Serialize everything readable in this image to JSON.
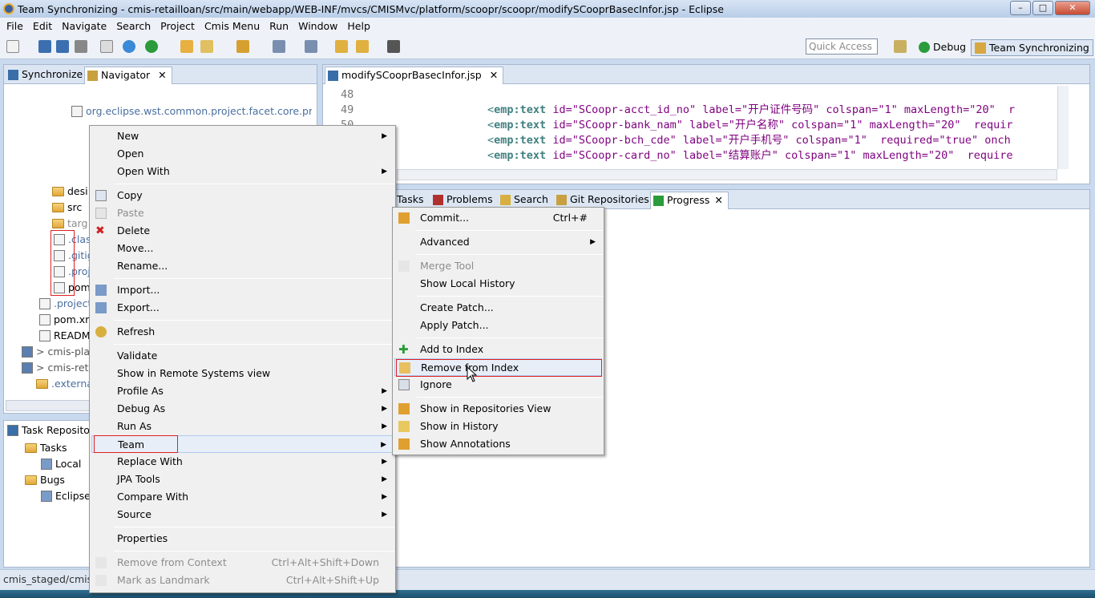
{
  "window": {
    "title": "Team Synchronizing - cmis-retailloan/src/main/webapp/WEB-INF/mvcs/CMISMvc/platform/scoopr/scoopr/modifySCooprBasecInfor.jsp - Eclipse",
    "minimize": "–",
    "maximize": "□",
    "close": "✕"
  },
  "menubar": [
    "File",
    "Edit",
    "Navigate",
    "Search",
    "Project",
    "Cmis Menu",
    "Run",
    "Window",
    "Help"
  ],
  "toolbar": {
    "quick_access_placeholder": "Quick Access",
    "perspective_debug": "Debug",
    "perspective_team": "Team Synchronizing"
  },
  "left_views": {
    "tab_synchronize": "Synchronize",
    "tab_navigator": "Navigator",
    "tree": [
      "org.eclipse.wst.common.project.facet.core.pref",
      "desi",
      "src",
      "targ",
      ".clas",
      ".gitig",
      ".proj",
      "pom",
      ".project",
      "pom.xml",
      "README",
      "> cmis-platform",
      "> cmis-retailloan",
      ".externalToolBuilders"
    ]
  },
  "task_repos": {
    "tab": "Task Repositories",
    "tasks": "Tasks",
    "local": "Local",
    "bugs": "Bugs",
    "eclipse": "Eclipse"
  },
  "editor": {
    "tab": "modifySCooprBasecInfor.jsp",
    "lines": [
      {
        "num": "48",
        "code": ""
      },
      {
        "num": "49",
        "tag": "emp:text",
        "attrs": "id=\"SCoopr-acct_id_no\" label=\"开户证件号码\" colspan=\"1\" maxLength=\"20\"  r"
      },
      {
        "num": "50",
        "tag": "emp:text",
        "attrs": "id=\"SCoopr-bank_nam\" label=\"开户名称\" colspan=\"1\" maxLength=\"20\"  requir"
      },
      {
        "num": "51",
        "tag": "emp:text",
        "attrs": "id=\"SCoopr-bch_cde\" label=\"开户手机号\" colspan=\"1\"  required=\"true\" onch"
      },
      {
        "num": "52",
        "tag": "emp:text",
        "attrs": "id=\"SCoopr-card_no\" label=\"结算账户\" colspan=\"1\" maxLength=\"20\"  require"
      }
    ]
  },
  "bottom_tabs": {
    "tasks": "Tasks",
    "problems": "Problems",
    "search": "Search",
    "git_repos": "Git Repositories",
    "progress": "Progress"
  },
  "context_menu": {
    "new": "New",
    "open": "Open",
    "open_with": "Open With",
    "copy": "Copy",
    "paste": "Paste",
    "delete": "Delete",
    "move": "Move...",
    "rename": "Rename...",
    "import": "Import...",
    "export": "Export...",
    "refresh": "Refresh",
    "validate": "Validate",
    "show_remote": "Show in Remote Systems view",
    "profile_as": "Profile As",
    "debug_as": "Debug As",
    "run_as": "Run As",
    "team": "Team",
    "replace_with": "Replace With",
    "jpa_tools": "JPA Tools",
    "compare_with": "Compare With",
    "source": "Source",
    "properties": "Properties",
    "remove_context": "Remove from Context",
    "remove_context_acc": "Ctrl+Alt+Shift+Down",
    "landmark": "Mark as Landmark",
    "landmark_acc": "Ctrl+Alt+Shift+Up"
  },
  "team_menu": {
    "commit": "Commit...",
    "commit_acc": "Ctrl+#",
    "advanced": "Advanced",
    "merge_tool": "Merge Tool",
    "local_history": "Show Local History",
    "create_patch": "Create Patch...",
    "apply_patch": "Apply Patch...",
    "add_index": "Add to Index",
    "remove_index": "Remove from Index",
    "ignore": "Ignore",
    "repos_view": "Show in Repositories View",
    "history": "Show in History",
    "annotations": "Show Annotations"
  },
  "status": {
    "text": "cmis_staged/cmis-"
  },
  "colors": {
    "accent_red": "#e02020",
    "tag_teal": "#3f7f7f",
    "attr_purple": "#7f007f",
    "value_blue": "#2a00ff"
  }
}
